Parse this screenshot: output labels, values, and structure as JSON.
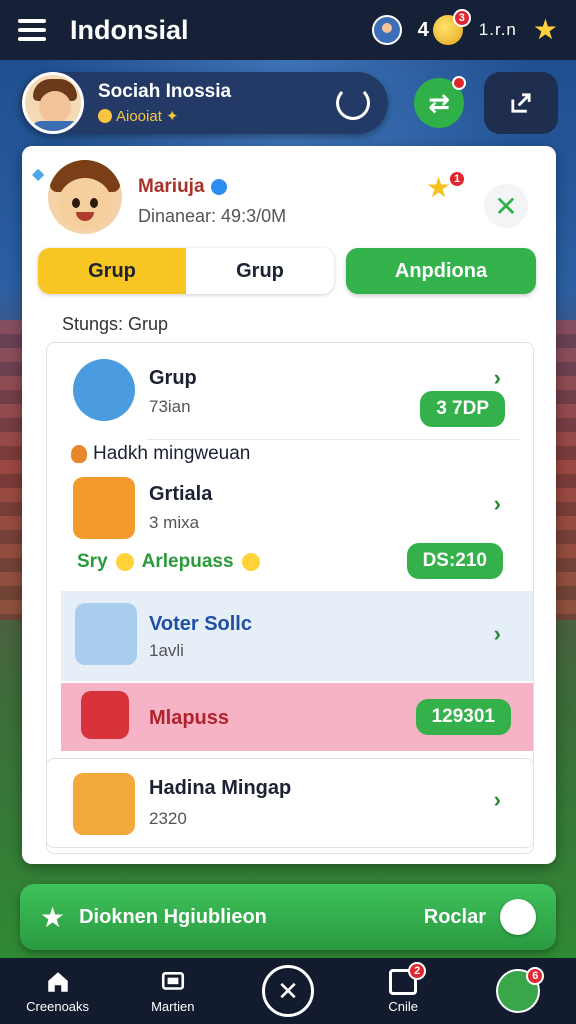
{
  "app": {
    "title": "Indonsial",
    "coin_count": "4",
    "coin_badge": "3",
    "status_text": "1.r.n"
  },
  "profile": {
    "name": "Sociah Inossia",
    "subtitle": "Aiooiat"
  },
  "green_button_badge": "",
  "card": {
    "user_name": "Mariuja",
    "user_meta": "Dinanear: 49:3/0M",
    "star_badge": "1"
  },
  "tabs": [
    {
      "label": "Grup",
      "active": true
    },
    {
      "label": "Grup",
      "active": false
    }
  ],
  "action_button": "Anpdiona",
  "section_label": "Stungs: Grup",
  "list": {
    "rows": [
      {
        "title": "Grup",
        "sub": "73ian",
        "pill": "3 7DP"
      },
      {
        "title": "Grtiala",
        "sub": "3 mixa",
        "pill": "DS:210"
      },
      {
        "title": "Voter Sollc",
        "sub": "1avli"
      },
      {
        "title": "Mlapuss",
        "pill": "129301"
      },
      {
        "title": "Hadina Mingap",
        "sub": "2320"
      }
    ],
    "note": "Hadkh mingweuan",
    "promo_left": "Sry",
    "promo_right": "Arlepuass"
  },
  "banner": {
    "text": "Dioknen Hgiublieon",
    "label": "Roclar"
  },
  "nav": [
    {
      "label": "Creenoaks"
    },
    {
      "label": "Martien"
    },
    {
      "label": ""
    },
    {
      "label": "Cnile"
    },
    {
      "label": ""
    }
  ],
  "nav_badges": {
    "cnile": "2",
    "avatar": "6"
  },
  "colors": {
    "accent_green": "#34b24c",
    "accent_yellow": "#f8c623",
    "topbar": "#162036"
  }
}
